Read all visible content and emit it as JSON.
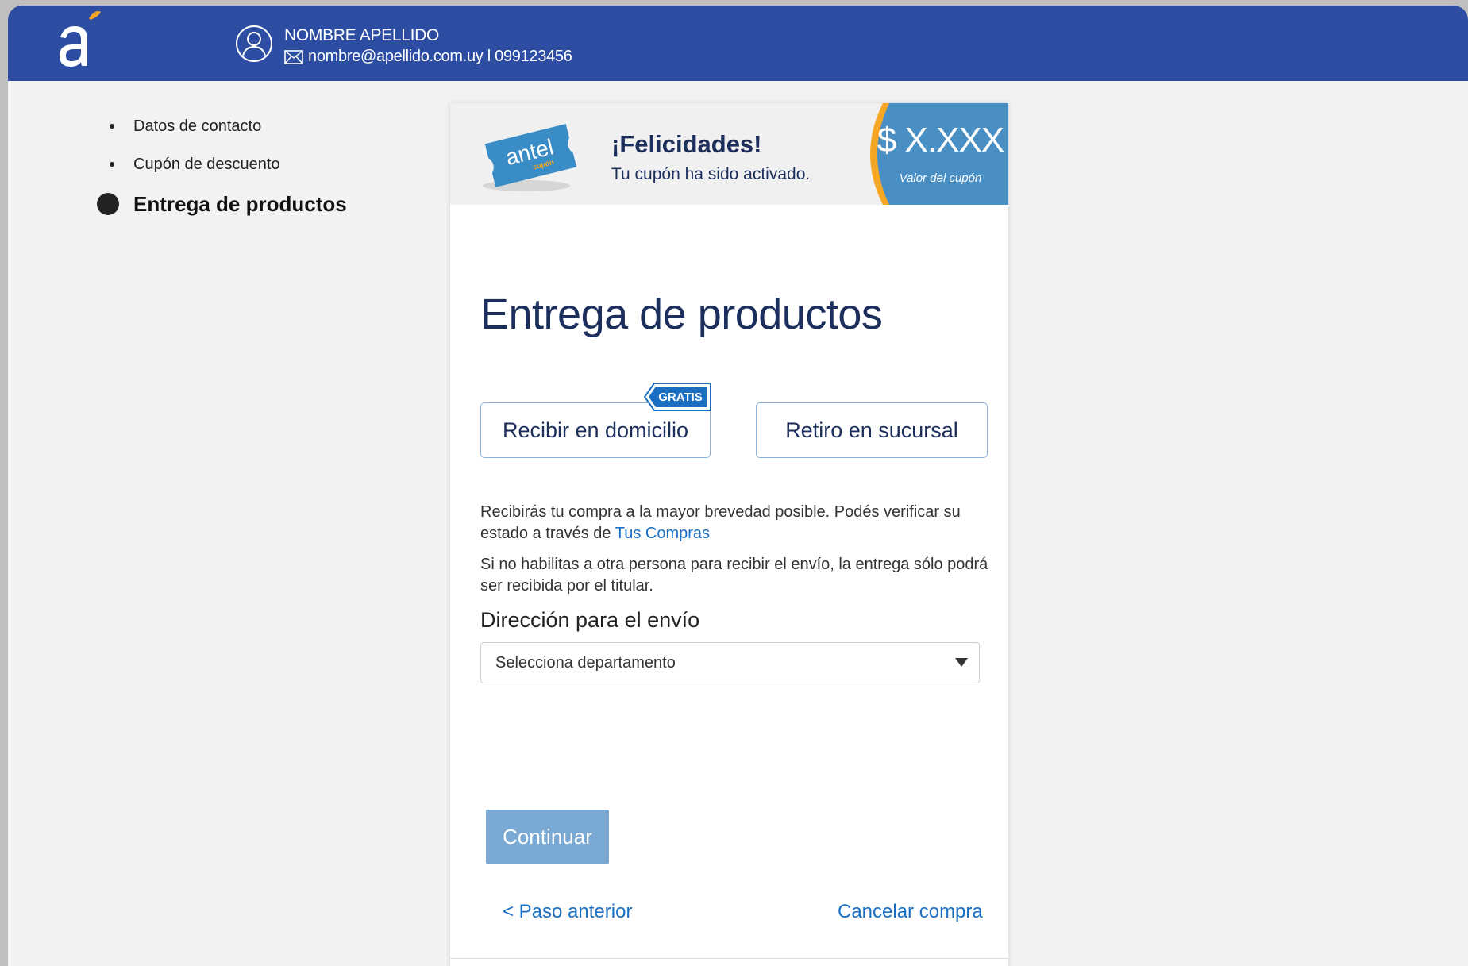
{
  "header": {
    "user_name": "NOMBRE APELLIDO",
    "user_contact": "nombre@apellido.com.uy l 099123456",
    "logo_icon": "antel-a-logo-icon",
    "user_icon": "user-circle-icon",
    "mail_icon": "envelope-icon",
    "bg_color": "#2d4da3"
  },
  "steps": [
    {
      "label": "Datos de contacto"
    },
    {
      "label": "Cupón de descuento"
    },
    {
      "label": "Entrega de productos"
    }
  ],
  "banner": {
    "ticket_text": "antel",
    "ticket_sub": "cupón",
    "title": "¡Felicidades!",
    "subtitle": "Tu cupón ha sido activado.",
    "price": "$ X.XXX",
    "price_label": "Valor del cupón"
  },
  "main": {
    "title": "Entrega de productos",
    "option_home": "Recibir en domicilio",
    "option_branch": "Retiro en sucursal",
    "badge": "GRATIS",
    "info1_text": "Recibirás tu compra a la mayor brevedad posible. Podés verificar su estado a través de ",
    "info1_link": "Tus Compras",
    "info2_text": "Si no habilitas a otra persona para recibir el envío, la entrega sólo podrá ser recibida por el titular.",
    "address_label": "Dirección para el envío",
    "select_value": "Selecciona departamento",
    "continue_label": "Continuar",
    "prev_label": "< Paso anterior",
    "cancel_label": "Cancelar compra"
  },
  "colors": {
    "brand_blue": "#2d4da3",
    "dark_navy": "#1c2f5c",
    "link_blue": "#1a6fc2",
    "button_disabled": "#7aaad4",
    "orange_accent": "#f5a623"
  }
}
